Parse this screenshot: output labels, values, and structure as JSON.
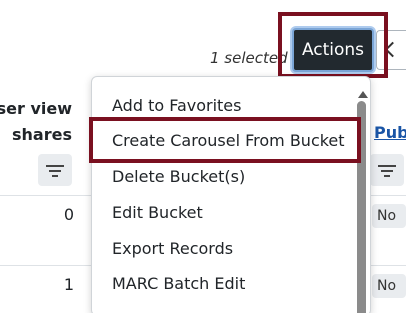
{
  "toolbar": {
    "selected_text": "1 selected",
    "actions_label": "Actions",
    "back_icon": "chevron-left-icon"
  },
  "table": {
    "columns": [
      {
        "label_line1": "user view",
        "label_line2": "shares"
      },
      {
        "label": "Pub"
      }
    ],
    "rows": [
      {
        "views": "0",
        "pub": "No"
      },
      {
        "views": "1",
        "pub": "No"
      }
    ]
  },
  "menu": {
    "items": [
      "Add to Favorites",
      "Create Carousel From Bucket",
      "Delete Bucket(s)",
      "Edit Bucket",
      "Export Records",
      "MARC Batch Edit"
    ],
    "highlighted_index": 1
  },
  "colors": {
    "highlight_border": "#7a1020",
    "actions_bg": "#22292f",
    "link": "#1a55a6"
  }
}
